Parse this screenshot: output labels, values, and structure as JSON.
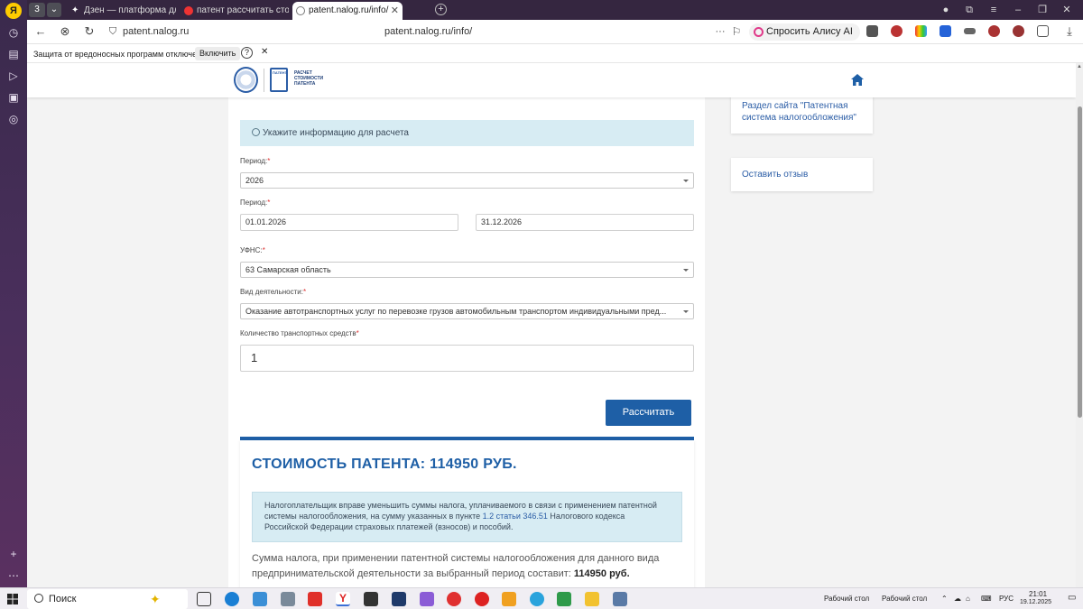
{
  "browser": {
    "tab_group_count": "3",
    "tabs": [
      {
        "title": "Дзен — платформа для п"
      },
      {
        "title": "патент рассчитать стоим"
      },
      {
        "title": "patent.nalog.ru/info/"
      }
    ],
    "domain": "patent.nalog.ru",
    "url": "patent.nalog.ru/info/",
    "more_dots": "···",
    "alice_label": "Спросить Алису AI",
    "infobar_text": "Защита от вредоносных программ отключена",
    "infobar_enable": "Включить",
    "infobar_help": "?",
    "infobar_close": "✕"
  },
  "site": {
    "logo_lines": [
      "РАСЧЕТ",
      "СТОИМОСТИ",
      "ПАТЕНТА"
    ],
    "patent_mark": "ПАТЕНТ"
  },
  "sidebar": {
    "link1": "Раздел сайта \"Патентная система налогообложения\"",
    "link2": "Оставить отзыв"
  },
  "form": {
    "hint": "Укажите информацию для расчета",
    "period_label": "Период:",
    "period_value": "2026",
    "period_range_label": "Период:",
    "date_from": "01.01.2026",
    "date_to": "31.12.2026",
    "ufns_label": "УФНС:",
    "ufns_value": "63 Самарская область",
    "activity_label": "Вид деятельности:",
    "activity_value": "Оказание автотранспортных услуг по перевозке грузов автомобильным транспортом индивидуальными пред...",
    "vehicles_label": "Количество транспортных средств",
    "vehicles_value": "1",
    "required_mark": "*",
    "calc_button": "Рассчитать"
  },
  "result": {
    "title": "СТОИМОСТЬ ПАТЕНТА: 114950 РУБ.",
    "note_part1": "Налогоплательщик вправе уменьшить суммы налога, уплачиваемого в связи с применением патентной системы налогообложения, на сумму указанных в пункте ",
    "note_link1": "1.2 статьи 346.51",
    "note_part2": " Налогового кодекса Российской Федерации страховых платежей (взносов) и пособий.",
    "summary_text": "Сумма налога, при применении патентной системы налогообложения для данного вида предпринимательской деятельности за выбранный период составит: ",
    "summary_amount": "114950 руб."
  },
  "taskbar": {
    "search_label": "Поиск",
    "desktop1": "Рабочий стол",
    "desktop2": "Рабочий стол",
    "lang": "РУС",
    "time": "21:01",
    "date": "19.12.2025"
  },
  "colors": {
    "brand_blue": "#1e5fa6",
    "info_bg": "#d7ecf3",
    "required": "#dd3333"
  }
}
